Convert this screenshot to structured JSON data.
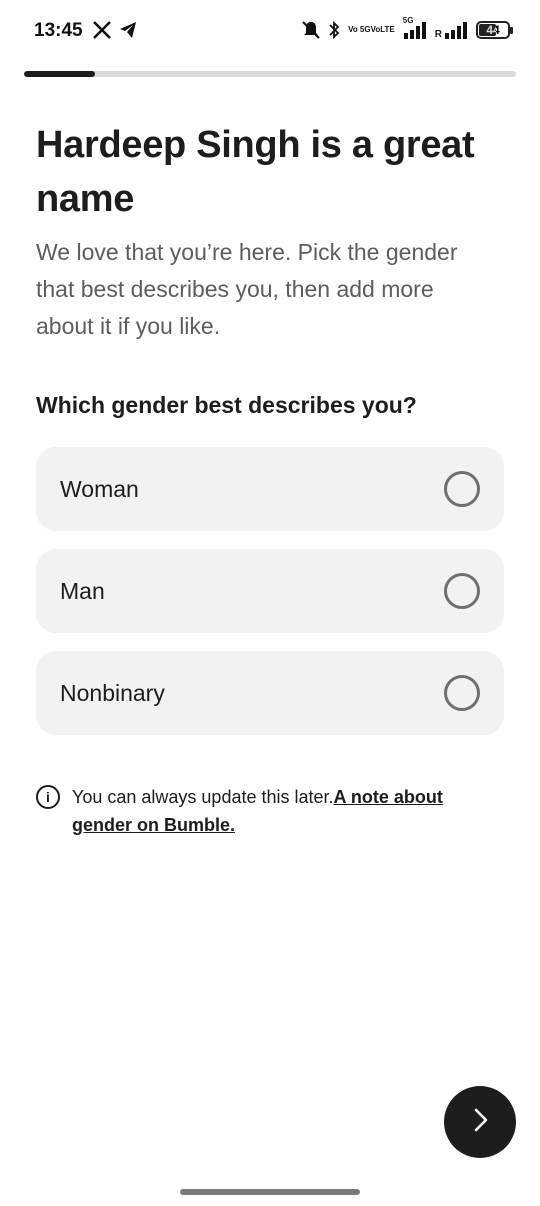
{
  "status_bar": {
    "time": "13:45",
    "left_icons": [
      "x-icon",
      "telegram-icon"
    ],
    "right_icons": [
      "mute-icon",
      "bluetooth-icon",
      "volte-icon",
      "5g-signal-icon",
      "signal-icon"
    ],
    "volte_top": "Vo 5G",
    "volte_bottom": "VoLTE",
    "network_label": "5G",
    "roaming_label": "R",
    "battery_level": "44"
  },
  "progress": {
    "value": 0.145
  },
  "heading": {
    "title": "Hardeep Singh is a great name",
    "subtitle": "We love that you’re here. Pick the gender that best describes you, then add more about it if you like."
  },
  "question": "Which gender best describes you?",
  "options": [
    {
      "label": "Woman",
      "selected": false
    },
    {
      "label": "Man",
      "selected": false
    },
    {
      "label": "Nonbinary",
      "selected": false
    }
  ],
  "note": {
    "text": "You can always update this later.",
    "link": "A note about gender on Bumble."
  },
  "next_button": {
    "icon": "chevron-right-icon"
  },
  "colors": {
    "text": "#1d1d1d",
    "muted": "#5d5d5d",
    "option_bg": "#f2f2f2",
    "track": "#dcdcdc",
    "accent": "#1d1d1d"
  }
}
